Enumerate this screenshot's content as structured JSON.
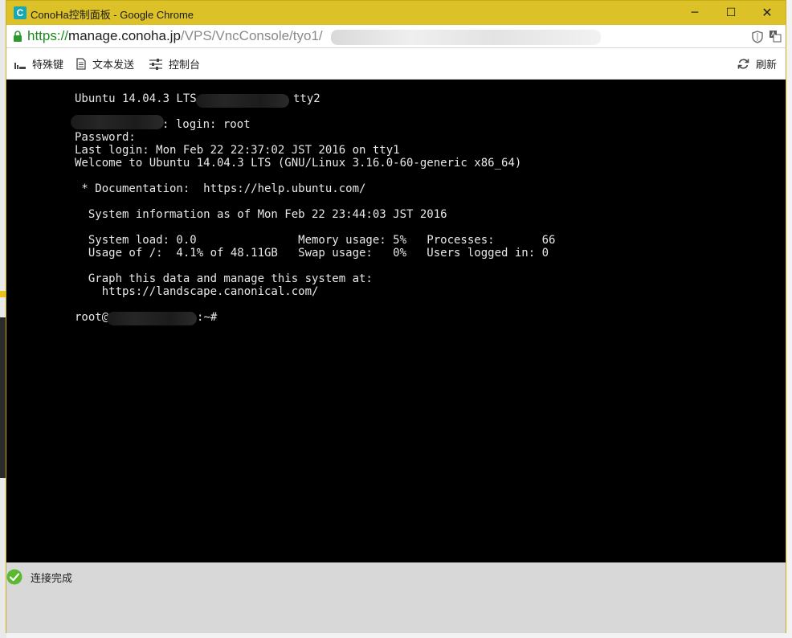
{
  "window": {
    "title": "ConoHa控制面板 - Google Chrome",
    "app_icon_letter": "C",
    "minimize": "─",
    "maximize": "☐",
    "close": "✕"
  },
  "address": {
    "scheme": "https://",
    "host": "manage.conoha.jp",
    "path": "/VPS/VncConsole/tyo1/"
  },
  "toolbar": {
    "special_keys": "特殊键",
    "send_text": "文本发送",
    "console": "控制台",
    "refresh": "刷新"
  },
  "terminal": {
    "lines": [
      "Ubuntu 14.04.3 LTS",
      "tty2",
      ": login: root",
      "Password:",
      "Last login: Mon Feb 22 22:37:02 JST 2016 on tty1",
      "Welcome to Ubuntu 14.04.3 LTS (GNU/Linux 3.16.0-60-generic x86_64)",
      " * Documentation:  https://help.ubuntu.com/",
      "  System information as of Mon Feb 22 23:44:03 JST 2016",
      "  System load: 0.0               Memory usage: 5%   Processes:       66",
      "  Usage of /:  4.1% of 48.11GB   Swap usage:   0%   Users logged in: 0",
      "  Graph this data and manage this system at:",
      "    https://landscape.canonical.com/",
      "root@",
      ":~#"
    ]
  },
  "status": {
    "text": "连接完成"
  },
  "colors": {
    "title_bar": "#dcc228",
    "terminal_bg": "#000000",
    "terminal_fg": "#e8e8e8",
    "status_ok": "#5cb82e",
    "url_scheme": "#1e8a1e"
  }
}
